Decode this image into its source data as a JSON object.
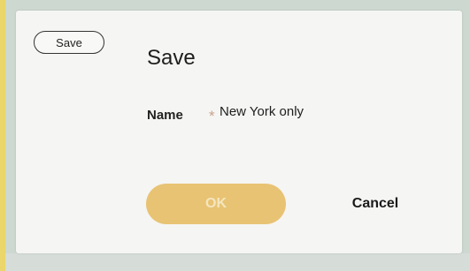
{
  "dialog": {
    "chip_label": "Save",
    "title": "Save",
    "name_label": "Name",
    "required_mark": "*",
    "name_value": "New York only",
    "ok_label": "OK",
    "cancel_label": "Cancel"
  },
  "colors": {
    "ok_button": "#e8c373",
    "required_mark": "#c9a28c",
    "dialog_background": "#f5f5f3"
  }
}
